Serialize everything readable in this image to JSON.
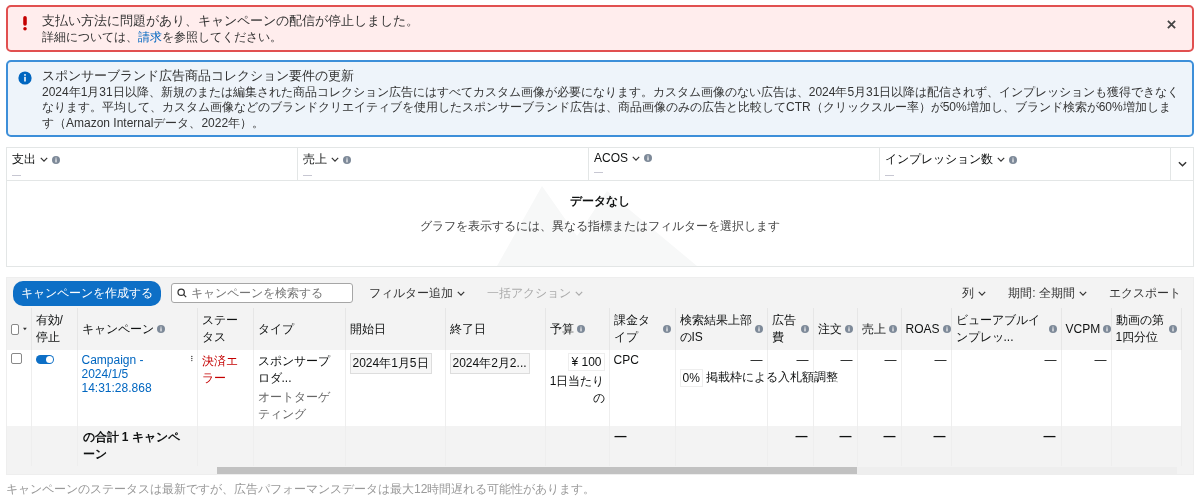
{
  "alerts": [
    {
      "kind": "error",
      "title": "支払い方法に問題があり、キャンペーンの配信が停止しました。",
      "body_before": "詳細については、",
      "link": "請求",
      "body_after": "を参照してください。",
      "dismissible": true
    },
    {
      "kind": "info",
      "title": "スポンサーブランド広告商品コレクション要件の更新",
      "body_before": "2024年1月31日以降、新規のまたは編集された商品コレクション広告にはすべてカスタム画像が必要になります。カスタム画像のない広告は、2024年5月31日以降は配信されず、インプレッションも獲得できなくなります。平均して、カスタム画像などのブランドクリエイティブを使用したスポンサーブランド広告は、商品画像のみの広告と比較してCTR（クリックスルー率）が50%増加し、ブランド検索が60%増加します（Amazon Internalデータ、2022年）。",
      "dismissible": false
    }
  ],
  "metrics": [
    {
      "label": "支出",
      "value": "—"
    },
    {
      "label": "売上",
      "value": "—"
    },
    {
      "label": "ACOS",
      "value": "—"
    },
    {
      "label": "インプレッション数",
      "value": "—"
    }
  ],
  "chart": {
    "title": "データなし",
    "message": "グラフを表示するには、異なる指標またはフィルターを選択します"
  },
  "toolbar": {
    "create_button": "キャンペーンを作成する",
    "search_placeholder": "キャンペーンを検索する",
    "filter": "フィルター追加",
    "bulk_action": {
      "label": "一括アクション",
      "disabled": true
    },
    "columns": "列",
    "period": "期間: 全期間",
    "export": "エクスポート"
  },
  "table": {
    "columns": [
      {
        "kind": "select",
        "checked": false
      },
      {
        "label": "有効/停止",
        "info": false
      },
      {
        "label": "キャンペーン",
        "info": true
      },
      {
        "label": "ステータス",
        "info": false
      },
      {
        "label": "タイプ",
        "info": false
      },
      {
        "label": "開始日",
        "info": false
      },
      {
        "label": "終了日",
        "info": false
      },
      {
        "label": "予算",
        "info": true
      },
      {
        "label": "課金タイプ",
        "info": true
      },
      {
        "label": "検索結果上部のIS",
        "info": true
      },
      {
        "label": "広告費",
        "info": true
      },
      {
        "label": "注文",
        "info": true
      },
      {
        "label": "売上",
        "info": true
      },
      {
        "label": "ROAS",
        "info": true
      },
      {
        "label": "ビューアブルインプレッ...",
        "info": true
      },
      {
        "label": "VCPM",
        "info": true
      },
      {
        "label": "動画の第1四分位",
        "info": true
      }
    ],
    "rows": [
      {
        "cells": [
          {
            "kind": "checkbox",
            "checked": false
          },
          {
            "kind": "toggle",
            "on": true
          },
          {
            "kind": "campaign",
            "text": "Campaign - 2024/1/5 14:31:28.868"
          },
          {
            "kind": "status",
            "text": "決済エラー"
          },
          {
            "kind": "type",
            "text": "スポンサープロダ...",
            "sub": "オートターゲティング"
          },
          {
            "kind": "date",
            "text": "2024年1月5日"
          },
          {
            "kind": "date",
            "text": "2024年2月2..."
          },
          {
            "kind": "budget",
            "text": "¥ 100",
            "sub": "1日当たりの"
          },
          {
            "kind": "text",
            "text": "CPC"
          },
          {
            "kind": "is",
            "text": "—",
            "value": "0%",
            "sub": "掲載枠による入札額調整"
          },
          {
            "kind": "dash",
            "text": "—"
          },
          {
            "kind": "dash",
            "text": "—"
          },
          {
            "kind": "dash",
            "text": "—"
          },
          {
            "kind": "dash",
            "text": "—"
          },
          {
            "kind": "dash",
            "text": "—"
          },
          {
            "kind": "dash",
            "text": "—"
          },
          {
            "kind": "blank"
          }
        ]
      }
    ],
    "total": {
      "cells": [
        {
          "kind": "blank"
        },
        {
          "kind": "blank"
        },
        {
          "kind": "total",
          "text": "の合計 1 キャンペーン"
        },
        {
          "kind": "blank"
        },
        {
          "kind": "blank"
        },
        {
          "kind": "blank"
        },
        {
          "kind": "blank"
        },
        {
          "kind": "blank"
        },
        {
          "kind": "text",
          "text": "—"
        },
        {
          "kind": "blank"
        },
        {
          "kind": "dash",
          "text": "—"
        },
        {
          "kind": "dash",
          "text": "—"
        },
        {
          "kind": "dash",
          "text": "—"
        },
        {
          "kind": "dash",
          "text": "—"
        },
        {
          "kind": "dash",
          "text": "—"
        },
        {
          "kind": "blank"
        },
        {
          "kind": "blank"
        }
      ]
    }
  },
  "footer_note": "キャンペーンのステータスは最新ですが、広告パフォーマンスデータは最大12時間遅れる可能性があります。"
}
